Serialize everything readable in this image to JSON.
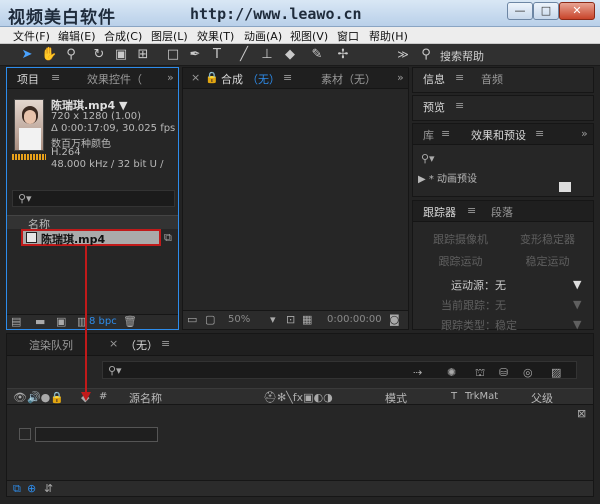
{
  "window": {
    "title": "视频美白软件",
    "url": "http://www.leawo.cn",
    "min_label": "—",
    "max_label": "□",
    "close_label": "✕"
  },
  "menu": [
    "文件(F)",
    "编辑(E)",
    "合成(C)",
    "图层(L)",
    "效果(T)",
    "动画(A)",
    "视图(V)",
    "窗口",
    "帮助(H)"
  ],
  "toolbar": {
    "search_icon": "search-icon",
    "search_label": "搜索帮助",
    "tools": [
      "select-arrow-icon",
      "hand-icon",
      "zoom-icon",
      "rotate-icon",
      "camera-icon",
      "pan-behind-icon",
      "rectangle-icon",
      "pen-icon",
      "text-icon",
      "brush-icon",
      "clone-stamp-icon",
      "eraser-icon",
      "roto-brush-icon",
      "puppet-icon"
    ]
  },
  "project_panel": {
    "tab_project": "项目",
    "tab_effects": "效果控件（",
    "file_name": "陈瑞琪.mp4 ▼",
    "resolution": "720 x 1280 (1.00)",
    "duration": "Δ 0:00:17:09, 30.025 fps",
    "colors": "数百万种颜色",
    "codec": "H.264",
    "audio": "48.000 kHz / 32 bit U /",
    "col_name": "名称",
    "item_name": "陈瑞琪.mp4",
    "bpc": "8 bpc"
  },
  "comp_panel": {
    "tab_comp": "合成",
    "tab_comp_value": "（无）",
    "tab_footage": "素材（无）",
    "zoom": "50%",
    "timecode": "0:00:00:00"
  },
  "info_panel": {
    "tab_info": "信息",
    "tab_audio": "音频",
    "tab_preview": "预览"
  },
  "effects_panel": {
    "tab_lib": "库",
    "tab_effects_presets": "效果和预设",
    "tree_item": "▶ * 动画预设"
  },
  "tracker_panel": {
    "tab_tracker": "跟踪器",
    "tab_paragraph": "段落",
    "btn_track_camera": "跟踪摄像机",
    "btn_warp_stabilizer": "变形稳定器",
    "btn_track_motion": "跟踪运动",
    "btn_stabilize_motion": "稳定运动",
    "motion_source_label": "运动源：",
    "motion_source_value": "无",
    "current_track_label": "当前跟踪：",
    "current_track_value": "无",
    "track_type_label": "跟踪类型：",
    "track_type_value": "稳定"
  },
  "timeline_panel": {
    "tab_render": "渲染队列",
    "tab_comp": "（无）",
    "col_hash": "#",
    "col_source": "源名称",
    "col_mode": "模式",
    "col_t": "T",
    "col_trkmat": "TrkMat",
    "col_parent": "父级"
  },
  "colors": {
    "accent_blue": "#2d8ceb",
    "highlight_red": "#c01a1a"
  }
}
